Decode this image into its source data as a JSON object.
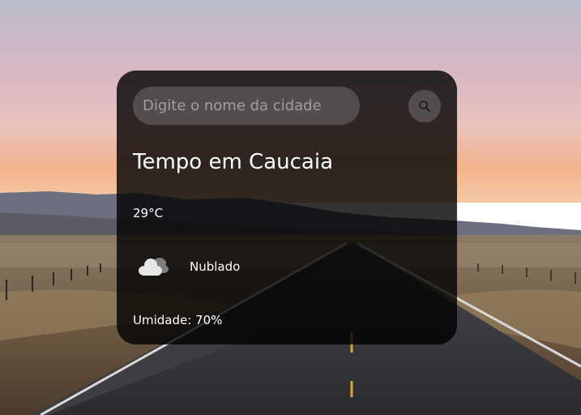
{
  "search": {
    "placeholder": "Digite o nome da cidade",
    "value": "",
    "button_icon": "search-icon"
  },
  "weather": {
    "title": "Tempo em Caucaia",
    "temperature": "29°C",
    "condition": "Nublado",
    "condition_icon": "cloud-icon",
    "humidity": "Umidade: 70%"
  },
  "colors": {
    "card_background": "#000000cc",
    "text": "#ffffff",
    "sky_top": "#b8bccb",
    "sky_horizon": "#f0b07a"
  }
}
